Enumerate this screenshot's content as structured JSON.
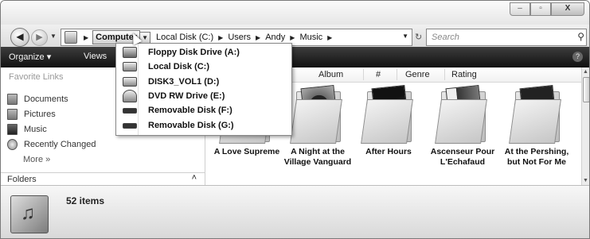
{
  "window": {
    "minimize_glyph": "–",
    "maximize_glyph": "▫",
    "close_glyph": "X"
  },
  "address_bar": {
    "breadcrumbs": [
      "Computer",
      "Local Disk (C:)",
      "Users",
      "Andy",
      "Music"
    ],
    "separator_glyph": "▶",
    "dropdown_glyph": "▼",
    "refresh_glyph": "↻"
  },
  "search": {
    "placeholder": "Search",
    "icon": "search-icon"
  },
  "toolbar": {
    "organize_label": "Organize ▾",
    "views_label": "Views"
  },
  "sidebar": {
    "title": "Favorite Links",
    "items": [
      "Documents",
      "Pictures",
      "Music",
      "Recently Changed"
    ],
    "more_label": "More »",
    "folders_label": "Folders",
    "folders_chevron": "˄"
  },
  "columns": [
    "Album",
    "#",
    "Genre",
    "Rating"
  ],
  "albums": [
    {
      "title_line1": "A Love Supreme",
      "title_line2": ""
    },
    {
      "title_line1": "A Night at the",
      "title_line2": "Village Vanguard"
    },
    {
      "title_line1": "After Hours",
      "title_line2": ""
    },
    {
      "title_line1": "Ascenseur Pour",
      "title_line2": "L'Echafaud"
    },
    {
      "title_line1": "At the Pershing,",
      "title_line2": "but Not For Me"
    }
  ],
  "status": {
    "item_count": "52 items"
  },
  "drive_menu": {
    "items": [
      "Floppy Disk Drive (A:)",
      "Local Disk (C:)",
      "DISK3_VOL1 (D:)",
      "DVD RW Drive (E:)",
      "Removable Disk (F:)",
      "Removable Disk (G:)"
    ],
    "icons": [
      "floppy-drive-icon",
      "local-disk-icon",
      "hard-disk-icon",
      "dvd-drive-icon",
      "removable-disk-icon",
      "removable-disk-icon"
    ]
  },
  "colors": {
    "toolbar_bg": "#1f1f1f",
    "highlight": "#cfcfcf"
  }
}
